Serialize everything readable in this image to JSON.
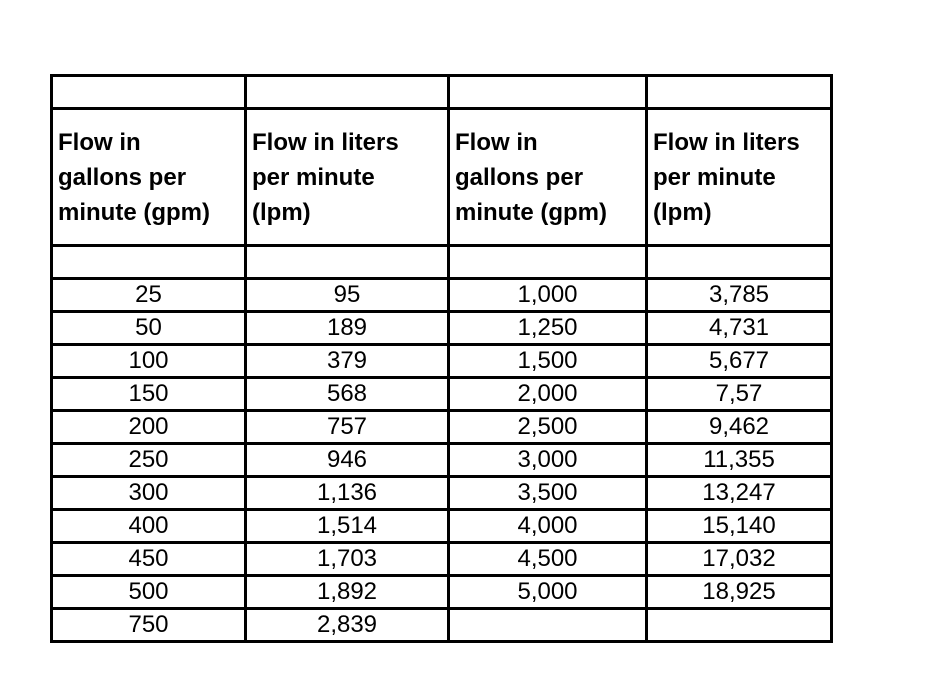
{
  "table": {
    "headers": [
      "Flow in\ngallons per\nminute (gpm)",
      "Flow in liters\nper minute\n(lpm)",
      "Flow in\ngallons per\nminute (gpm)",
      "Flow in liters\nper minute\n(lpm)"
    ],
    "rows": [
      [
        "25",
        "95",
        "1,000",
        "3,785"
      ],
      [
        "50",
        "189",
        "1,250",
        "4,731"
      ],
      [
        "100",
        "379",
        "1,500",
        "5,677"
      ],
      [
        "150",
        "568",
        "2,000",
        "7,57"
      ],
      [
        "200",
        "757",
        "2,500",
        "9,462"
      ],
      [
        "250",
        "946",
        "3,000",
        "11,355"
      ],
      [
        "300",
        "1,136",
        "3,500",
        "13,247"
      ],
      [
        "400",
        "1,514",
        "4,000",
        "15,140"
      ],
      [
        "450",
        "1,703",
        "4,500",
        "17,032"
      ],
      [
        "500",
        "1,892",
        "5,000",
        "18,925"
      ],
      [
        "750",
        "2,839",
        "",
        ""
      ]
    ]
  }
}
